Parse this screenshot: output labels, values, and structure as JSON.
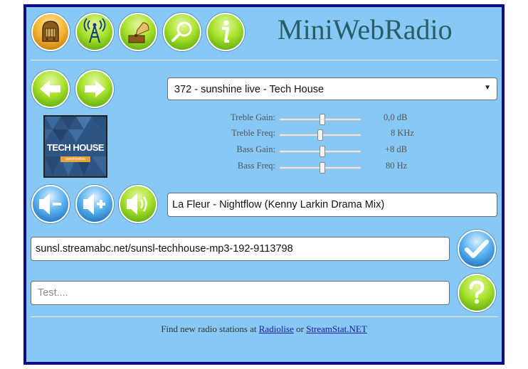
{
  "app": {
    "title": "MiniWebRadio"
  },
  "toolbar": [
    {
      "name": "radio-icon"
    },
    {
      "name": "antenna-icon"
    },
    {
      "name": "gramophone-icon"
    },
    {
      "name": "search-icon"
    },
    {
      "name": "info-icon"
    }
  ],
  "navigation": {
    "previous": "arrow-left-icon",
    "next": "arrow-right-icon"
  },
  "station_select": {
    "selected": "372 - sunshine live - Tech House"
  },
  "cover": {
    "title": "TECH HOUSE",
    "badge": "sunshinelive"
  },
  "equalizer": {
    "treble_gain": {
      "label": "Treble Gain:",
      "value": "0,0 dB",
      "level": 0.53
    },
    "treble_freq": {
      "label": "Treble Freq:",
      "value": "8 KHz",
      "level": 0.5
    },
    "bass_gain": {
      "label": "Bass Gain:",
      "value": "+8 dB",
      "level": 0.53
    },
    "bass_freq": {
      "label": "Bass Freq:",
      "value": "80 Hz",
      "level": 0.53
    }
  },
  "volume": {
    "down": "volume-down-icon",
    "up": "volume-up-icon",
    "mute": "speaker-icon"
  },
  "now_playing": {
    "text": "La Fleur - Nightflow (Kenny Larkin Drama Mix)"
  },
  "stream_url": {
    "value": "sunsl.streamabc.net/sunsl-techhouse-mp3-192-9113798"
  },
  "test_input": {
    "placeholder": "Test...."
  },
  "footer": {
    "prefix": "Find new radio stations at",
    "link1": "Radiolise",
    "middle": "or",
    "link2": "StreamStat.NET"
  }
}
